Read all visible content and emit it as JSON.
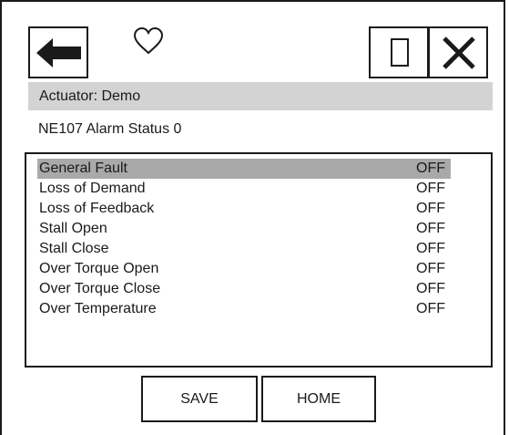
{
  "header": {
    "back_icon": "arrow-left-icon",
    "favorite_icon": "heart-outline-icon",
    "window_icon": "square-outline-icon",
    "close_icon": "close-x-icon"
  },
  "actuator": {
    "label": "Actuator: Demo"
  },
  "page": {
    "title": "NE107 Alarm Status 0"
  },
  "alarms": [
    {
      "label": "General Fault",
      "value": "OFF",
      "selected": true
    },
    {
      "label": "Loss of Demand",
      "value": "OFF"
    },
    {
      "label": "Loss of Feedback",
      "value": "OFF"
    },
    {
      "label": "Stall Open",
      "value": "OFF"
    },
    {
      "label": "Stall Close",
      "value": "OFF"
    },
    {
      "label": "Over Torque Open",
      "value": "OFF"
    },
    {
      "label": "Over Torque Close",
      "value": "OFF"
    },
    {
      "label": "Over Temperature",
      "value": "OFF"
    }
  ],
  "footer": {
    "save_label": "SAVE",
    "home_label": "HOME"
  },
  "colors": {
    "header_bar": "#d3d3d3",
    "selected_row": "#a9a9a9",
    "ink": "#1a1a1a"
  }
}
